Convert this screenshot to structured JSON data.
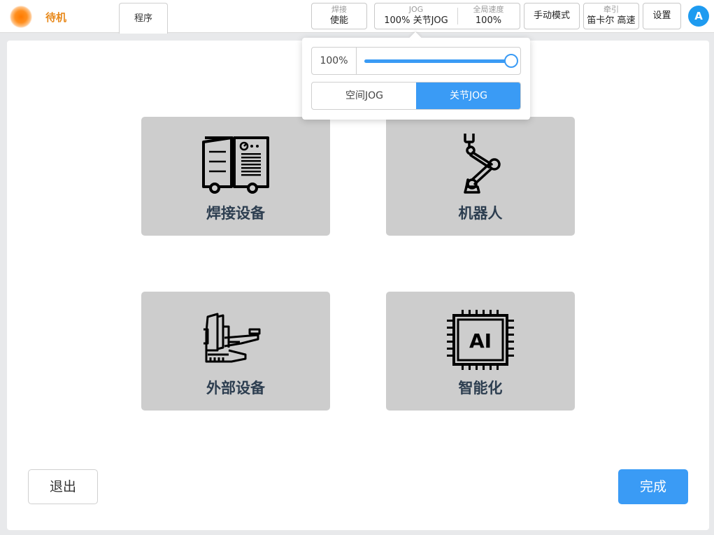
{
  "header": {
    "status": "待机",
    "program_tab": "程序",
    "weld": {
      "caption": "焊接",
      "value": "使能"
    },
    "jog": {
      "caption": "JOG",
      "value": "100%  关节JOG"
    },
    "global_speed": {
      "caption": "全局速度",
      "value": "100%"
    },
    "manual_mode": "手动模式",
    "traction": {
      "caption": "牵引",
      "value": "笛卡尔 高速"
    },
    "settings": "设置",
    "user_initial": "A"
  },
  "jog_popup": {
    "speed_label": "100%",
    "speed_percent": 100,
    "modes": [
      "空间JOG",
      "关节JOG"
    ],
    "selected_mode": "关节JOG"
  },
  "cards": [
    {
      "label": "焊接设备",
      "icon": "welding-machine-icon"
    },
    {
      "label": "机器人",
      "icon": "robot-arm-icon"
    },
    {
      "label": "外部设备",
      "icon": "positioner-icon"
    },
    {
      "label": "智能化",
      "icon": "ai-chip-icon"
    }
  ],
  "footer": {
    "exit": "退出",
    "done": "完成"
  },
  "colors": {
    "accent": "#3a9bf5",
    "status": "#e8891b",
    "card_bg": "#cdcdcd",
    "card_text": "#2d3e50"
  }
}
